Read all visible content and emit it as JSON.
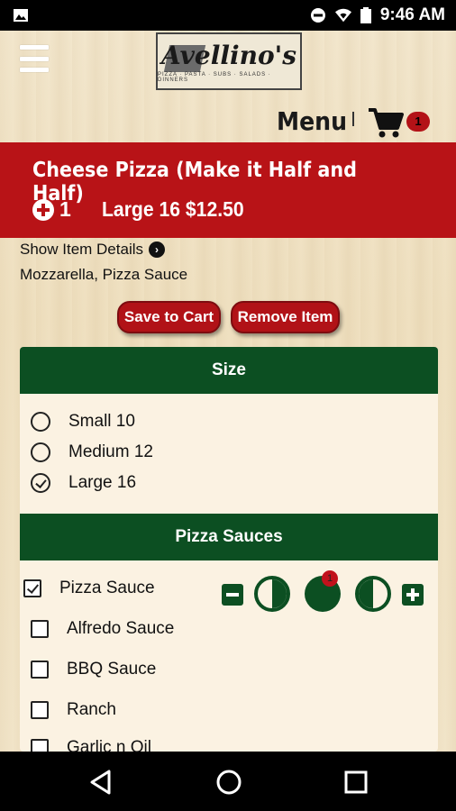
{
  "status_bar": {
    "time": "9:46 AM",
    "icons": [
      "image-icon",
      "do-not-disturb-icon",
      "wifi-icon",
      "battery-icon"
    ]
  },
  "header": {
    "logo_name": "Avellino's",
    "logo_tagline": "PIZZA · PASTA · SUBS · SALADS · DINNERS",
    "menu_label": "Menu",
    "cart_count": "1"
  },
  "item": {
    "title": "Cheese Pizza (Make it Half and Half)",
    "quantity": "1",
    "size_price": "Large 16 $12.50",
    "details_link": "Show Item Details",
    "ingredients": "Mozzarella, Pizza Sauce"
  },
  "actions": {
    "save_label": "Save to Cart",
    "remove_label": "Remove Item"
  },
  "size_section": {
    "title": "Size",
    "options": [
      {
        "label": "Small 10",
        "checked": false
      },
      {
        "label": "Medium 12",
        "checked": false
      },
      {
        "label": "Large 16",
        "checked": true
      }
    ]
  },
  "sauce_section": {
    "title": "Pizza Sauces",
    "options": [
      {
        "label": "Pizza Sauce",
        "checked": true
      },
      {
        "label": "Alfredo Sauce",
        "checked": false
      },
      {
        "label": "BBQ Sauce",
        "checked": false
      },
      {
        "label": "Ranch",
        "checked": false
      },
      {
        "label": "Garlic n Oil",
        "checked": false
      }
    ],
    "portion_badge": "1"
  },
  "colors": {
    "banner_red": "#b81317",
    "section_green": "#0c4f22",
    "panel_bg": "#fbf2e2"
  }
}
